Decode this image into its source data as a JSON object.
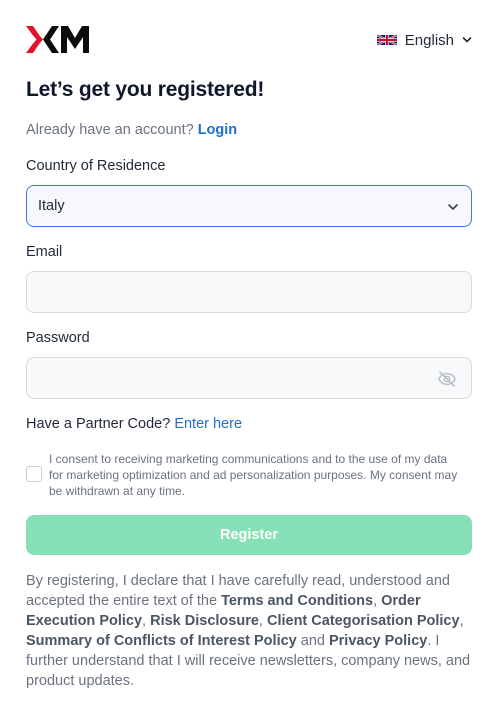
{
  "header": {
    "logo_text": "XM",
    "language": {
      "label": "English",
      "flag_icon": "uk-flag-icon",
      "chevron_icon": "chevron-down-icon"
    }
  },
  "title": "Let’s get you registered!",
  "login_prompt": {
    "text": "Already have an account?",
    "link": "Login"
  },
  "country": {
    "label": "Country of Residence",
    "value": "Italy"
  },
  "email": {
    "label": "Email",
    "value": ""
  },
  "password": {
    "label": "Password",
    "value": "",
    "icon": "eye-off-icon"
  },
  "partner": {
    "text": "Have a Partner Code?",
    "link": "Enter here"
  },
  "consent": {
    "checked": false,
    "text": "I consent to receiving marketing communications and to the use of my data for marketing optimization and ad personalization purposes. My consent may be withdrawn at any time."
  },
  "register_button": "Register",
  "legal": {
    "part1": "By registering, I declare that I have carefully read, understood and accepted the entire text of the ",
    "terms": "Terms and Conditions",
    "sep1": ", ",
    "order_execution": "Order Execution Policy",
    "sep2": ", ",
    "risk": "Risk Disclosure",
    "sep3": ", ",
    "client_cat": "Client Categorisation Policy",
    "sep4": ", ",
    "conflicts": "Summary of Conflicts of Interest Policy",
    "sep5": " and ",
    "privacy": "Privacy Policy",
    "part2": ". I further understand that I will receive newsletters, company news, and product updates."
  },
  "colors": {
    "link": "#1f6fd1",
    "register_bg": "#86e0b6",
    "brand_red": "#e1142d"
  }
}
